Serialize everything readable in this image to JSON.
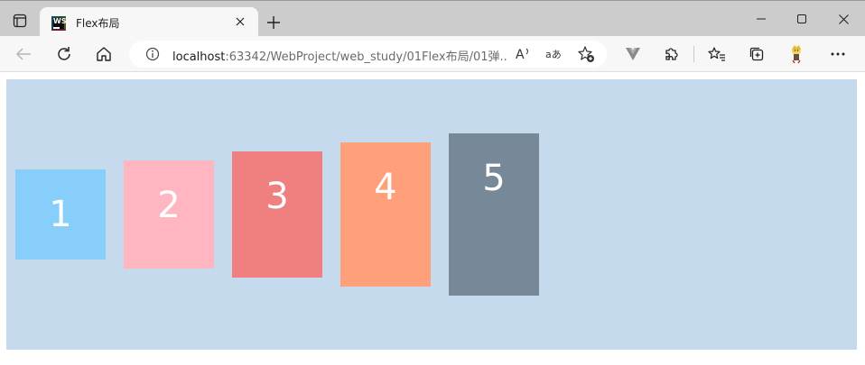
{
  "browser": {
    "tab": {
      "title": "Flex布局",
      "favicon_text": "WS"
    },
    "address": {
      "host": "localhost",
      "path": ":63342/WebProject/web_study/01Flex布局/01弹..."
    },
    "read_aloud_label": "A",
    "translate_label": "aあ"
  },
  "page": {
    "container_color": "#c6daee",
    "boxes": [
      {
        "label": "1",
        "color": "#87cefa"
      },
      {
        "label": "2",
        "color": "#ffb6c1"
      },
      {
        "label": "3",
        "color": "#f08080"
      },
      {
        "label": "4",
        "color": "#ffa07a"
      },
      {
        "label": "5",
        "color": "#778899"
      }
    ]
  }
}
